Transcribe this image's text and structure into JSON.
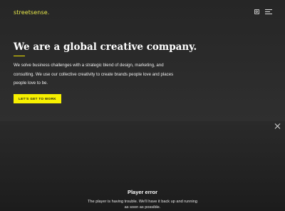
{
  "header": {
    "logo_text": "streetsense.",
    "icons": {
      "search": "search-icon",
      "menu": "hamburger-menu-icon"
    },
    "accent_color": "#f2e600"
  },
  "hero": {
    "headline": "We are a global creative company.",
    "description_line1": "We solve business challenges with a strategic blend of design, marketing, and",
    "description_line2": "consulting. We use our collective creativity to create brands people love and places",
    "description_line3": "people love to be.",
    "cta_label": "LET'S GET TO WORK"
  },
  "player": {
    "close_icon": "close-icon",
    "error_title": "Player error",
    "error_message_line1": "The player is having trouble. We'll have it back up and running",
    "error_message_line2": "as soon as possible."
  }
}
